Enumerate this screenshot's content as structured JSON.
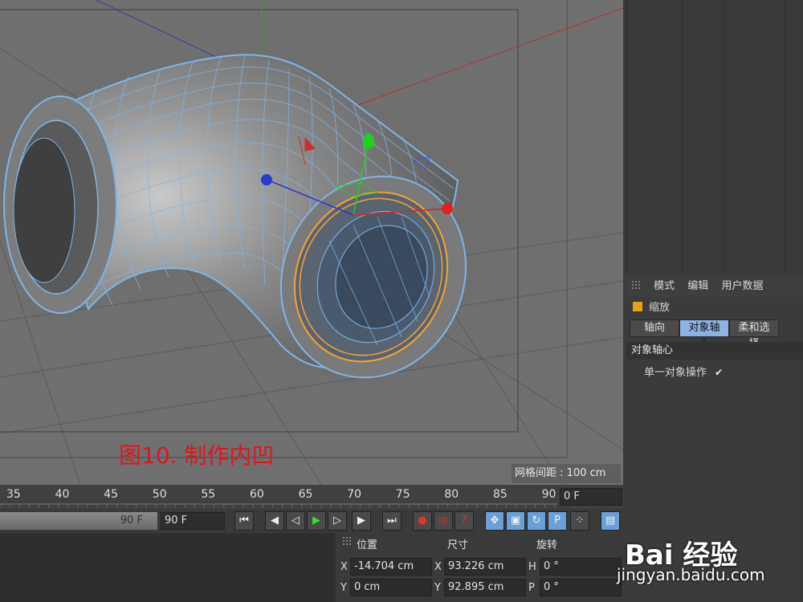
{
  "caption": "图10. 制作内凹",
  "viewport": {
    "grid_spacing": "网格间距 : 100 cm"
  },
  "attributes": {
    "menu": [
      "模式",
      "编辑",
      "用户数据"
    ],
    "title": "缩放",
    "tabs": [
      "轴向",
      "对象轴心",
      "柔和选择"
    ],
    "active_tab": "对象轴心",
    "section": "对象轴心",
    "property": "单一对象操作",
    "property_checked": "✔"
  },
  "timeline": {
    "ticks": [
      "35",
      "40",
      "45",
      "50",
      "55",
      "60",
      "65",
      "70",
      "75",
      "80",
      "85",
      "90"
    ],
    "current_frame": "0 F"
  },
  "transport": {
    "range_end": "90 F",
    "end_frame": "90 F"
  },
  "coordinates": {
    "headers": [
      "位置",
      "尺寸",
      "旋转"
    ],
    "rows": [
      {
        "axis1": "X",
        "pos": "-14.704 cm",
        "axis2": "X",
        "size": "93.226 cm",
        "axis3": "H",
        "rot": "0 °"
      },
      {
        "axis1": "Y",
        "pos": "0 cm",
        "axis2": "Y",
        "size": "92.895 cm",
        "axis3": "P",
        "rot": "0 °"
      }
    ]
  },
  "watermark": {
    "main": "Bai 经验",
    "sub": "jingyan.baidu.com"
  },
  "colors": {
    "viewport_bg": "#6f6f6f",
    "mesh": "#7fb4e6",
    "selection": "#f2a23a",
    "caption": "#e0141e"
  }
}
